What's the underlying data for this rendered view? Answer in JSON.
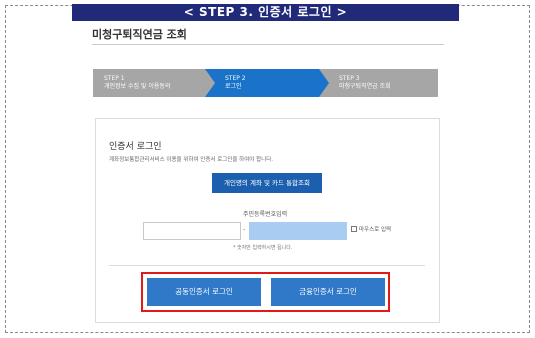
{
  "banner": {
    "text": "< STEP 3. 인증서 로그인 >"
  },
  "page": {
    "title": "미청구퇴직연금 조회"
  },
  "steps": [
    {
      "no": "STEP 1",
      "name": "개인정보 수집 및 이용동의",
      "active": false
    },
    {
      "no": "STEP 2",
      "name": "로그인",
      "active": true
    },
    {
      "no": "STEP 3",
      "name": "미청구퇴직연금 조회",
      "active": false
    }
  ],
  "login": {
    "title": "인증서 로그인",
    "description": "계좌정보통합관리서비스 이용을 위하여 인증서 로그인을 하여야 합니다.",
    "account_button": "개인명의 계좌 및 카드 통합조회",
    "rrn_label": "주민등록번호입력",
    "rrn_front_value": "",
    "rrn_back_value": "",
    "rrn_dash": "-",
    "mouse_input_label": "마우스로 입력",
    "hint": "* 숫자만 입력하시면 됩니다.",
    "joint_cert_button": "공동인증서 로그인",
    "finance_cert_button": "금융인증서 로그인"
  },
  "colors": {
    "banner_bg": "#202a78",
    "active_step": "#1a73c8",
    "inactive_step": "#a6a6a6",
    "button_blue": "#2f79c8",
    "highlight_red": "#e11919"
  }
}
